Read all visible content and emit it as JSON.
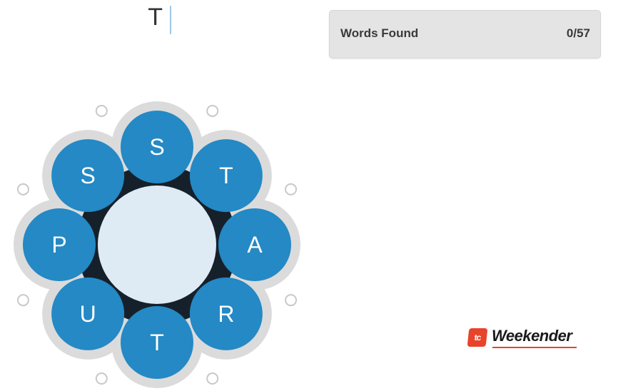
{
  "input": {
    "typed": "T"
  },
  "words_found": {
    "label": "Words Found",
    "count": "0/57"
  },
  "board": {
    "center_letter": "",
    "letters": [
      "S",
      "T",
      "A",
      "R",
      "T",
      "U",
      "P",
      "S"
    ]
  },
  "logo": {
    "badge": "tc",
    "text": "Weekender"
  },
  "colors": {
    "tile": "#2489c5",
    "center": "#deeaf4",
    "ring": "#dbdbdb",
    "hub": "#16202b",
    "accent": "#e8432b"
  }
}
